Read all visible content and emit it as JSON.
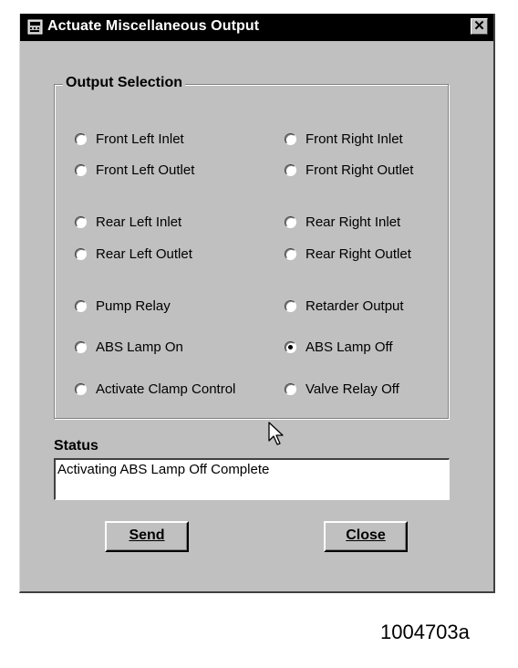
{
  "window": {
    "title": "Actuate Miscellaneous Output",
    "close_glyph": "✕"
  },
  "output_selection": {
    "label": "Output Selection",
    "options": [
      {
        "label": "Front Left Inlet",
        "checked": false
      },
      {
        "label": "Front Right Inlet",
        "checked": false
      },
      {
        "label": "Front Left Outlet",
        "checked": false
      },
      {
        "label": "Front Right Outlet",
        "checked": false
      },
      {
        "label": "Rear Left Inlet",
        "checked": false
      },
      {
        "label": "Rear Right Inlet",
        "checked": false
      },
      {
        "label": "Rear Left Outlet",
        "checked": false
      },
      {
        "label": "Rear Right Outlet",
        "checked": false
      },
      {
        "label": "Pump Relay",
        "checked": false
      },
      {
        "label": "Retarder Output",
        "checked": false
      },
      {
        "label": "ABS Lamp On",
        "checked": false
      },
      {
        "label": "ABS Lamp Off",
        "checked": true
      },
      {
        "label": "Activate Clamp Control",
        "checked": false
      },
      {
        "label": "Valve Relay Off",
        "checked": false
      }
    ]
  },
  "status": {
    "label": "Status",
    "text": "Activating ABS Lamp Off  Complete"
  },
  "buttons": {
    "send": "Send",
    "close": "Close"
  },
  "icons": {
    "title_icon": "app-window-icon",
    "close_icon": "close-icon",
    "pointer": "mouse-pointer-icon"
  },
  "figure_id": "1004703a"
}
